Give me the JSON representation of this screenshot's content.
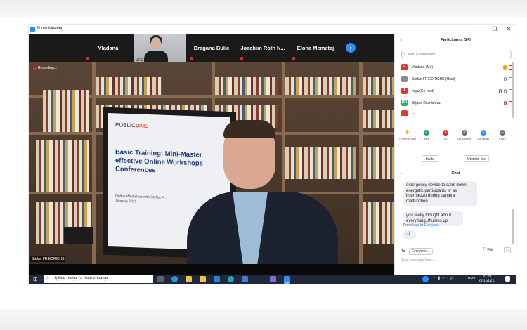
{
  "window": {
    "title": "Zoom Meeting",
    "minimize": "–",
    "restore": "❐",
    "close": "✕"
  },
  "strip": {
    "tiles": [
      "Vladana",
      "Dragana Bulic",
      "Joachim  Roth  N...",
      "Elona Memetaj"
    ],
    "photo_label": "Inga",
    "next_icon": "›"
  },
  "video": {
    "recording_label": "Recording...",
    "speaker": "Stefan FRIEDRICHS",
    "slide": {
      "logo_a": "PUBLIC",
      "logo_b": "ONE",
      "title": "Basic Training: Mini-Master effective Online Workshops Conferences",
      "subtitle": "Online-Workshop with Stefan F...",
      "date": "January 2021"
    }
  },
  "participants": {
    "header": "Participants (24)",
    "search_placeholder": "Find a participant",
    "list": [
      {
        "initial": "V",
        "name": "Vladana (Me)",
        "color": "#d93a2b"
      },
      {
        "initial": "",
        "name": "Stefan FRIEDRICHS (Host)",
        "color": "#8a8a8a"
      },
      {
        "initial": "I",
        "name": "Inga (Co-host)",
        "color": "#d93a2b"
      },
      {
        "initial": "BD",
        "name": "Biljana Dijanisieva",
        "color": "#2fae6a"
      },
      {
        "initial": "",
        "name": "...",
        "color": "#d93a2b"
      }
    ],
    "reactions": [
      {
        "label": "Raise Hand",
        "icon": "✋",
        "color": "#2d8cff"
      },
      {
        "label": "yes",
        "icon": "✓",
        "color": "#22a35a"
      },
      {
        "label": "no",
        "icon": "✕",
        "color": "#e02828"
      },
      {
        "label": "go slower",
        "icon": "«",
        "color": "#6e6e7a"
      },
      {
        "label": "go faster",
        "icon": "»",
        "color": "#2d8cff"
      },
      {
        "label": "more",
        "icon": "•••",
        "color": "#6e6e7a"
      }
    ],
    "invite": "Invite",
    "unmute": "Unmute Me"
  },
  "chat": {
    "header": "Chat",
    "messages": [
      "emergency device to calm down energetic participants or as intermezzo during camera malfunction...",
      "you really thought about everything..thumbs up"
    ],
    "from_prefix": "From",
    "from_user": "Inga",
    "from_to": "to",
    "from_target": "Everyone",
    "last_message": ":-)",
    "to_label": "To:",
    "to_value": "Everyone ⌄",
    "file_label": "File",
    "more_label": "···",
    "input_placeholder": "Type message here..."
  },
  "taskbar": {
    "search_text": "Upišite ovdje za pretraživanje",
    "language": "HRV",
    "time": "10:29",
    "date": "29.1.2021."
  }
}
